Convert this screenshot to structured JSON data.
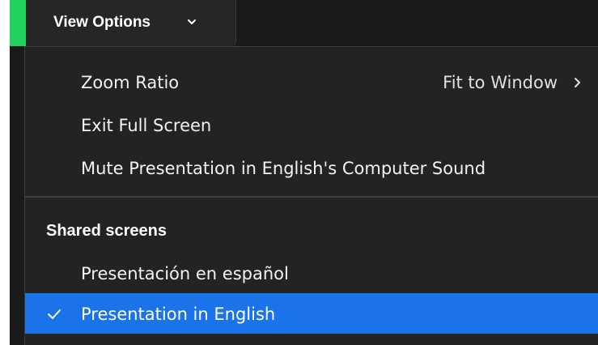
{
  "toolbar": {
    "view_options_label": "View Options",
    "chevron_icon": "chevron-down-icon",
    "accent_color": "#23d160"
  },
  "menu": {
    "items": [
      {
        "label": "Zoom Ratio",
        "value": "Fit to Window",
        "icon": "chevron-right-icon"
      },
      {
        "label": "Exit Full Screen"
      },
      {
        "label": "Mute Presentation in English's Computer Sound"
      }
    ],
    "shared_section": {
      "header": "Shared screens",
      "screens": [
        {
          "label": "Presentación en español",
          "selected": false
        },
        {
          "label": "Presentation in English",
          "selected": true,
          "icon": "checkmark-icon"
        }
      ]
    },
    "selected_color": "#1a73e8",
    "background_color": "#232323"
  }
}
